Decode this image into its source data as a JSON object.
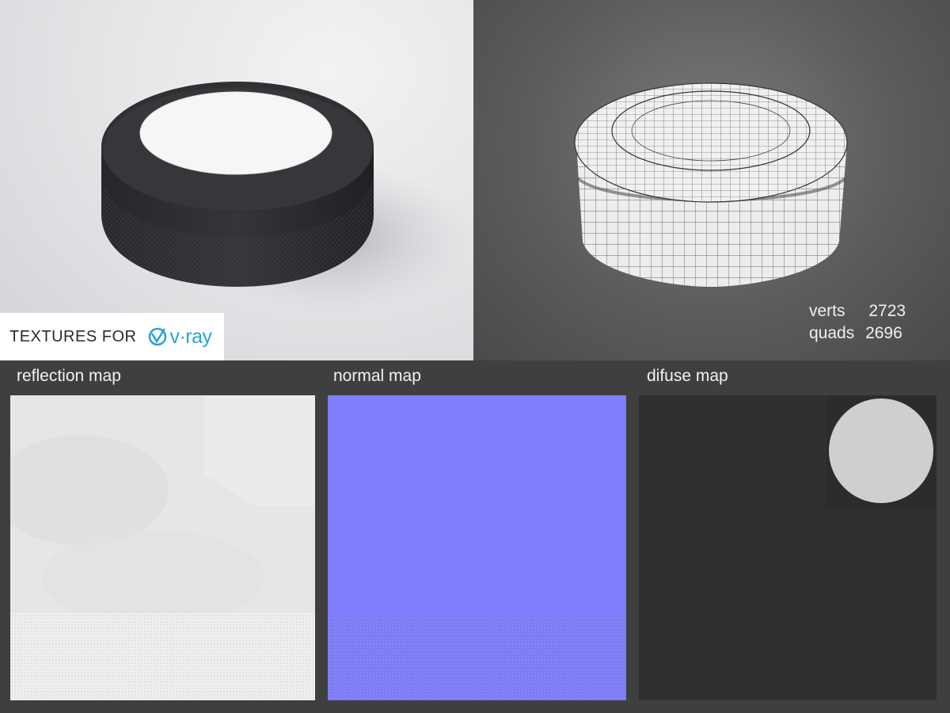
{
  "badge": {
    "label": "TEXTURES FOR",
    "logo_text": "v·ray"
  },
  "stats": {
    "verts_label": "verts",
    "verts_value": "2723",
    "quads_label": "quads",
    "quads_value": "2696"
  },
  "maps": {
    "reflection_label": "reflection map",
    "normal_label": "normal map",
    "diffuse_label": "difuse map"
  },
  "colors": {
    "puck": "#2f3033",
    "normal_map": "#7f7ffd",
    "diffuse_dark": "#303030",
    "diffuse_disc": "#cfcfcf",
    "vray_brand": "#29a3d6"
  }
}
